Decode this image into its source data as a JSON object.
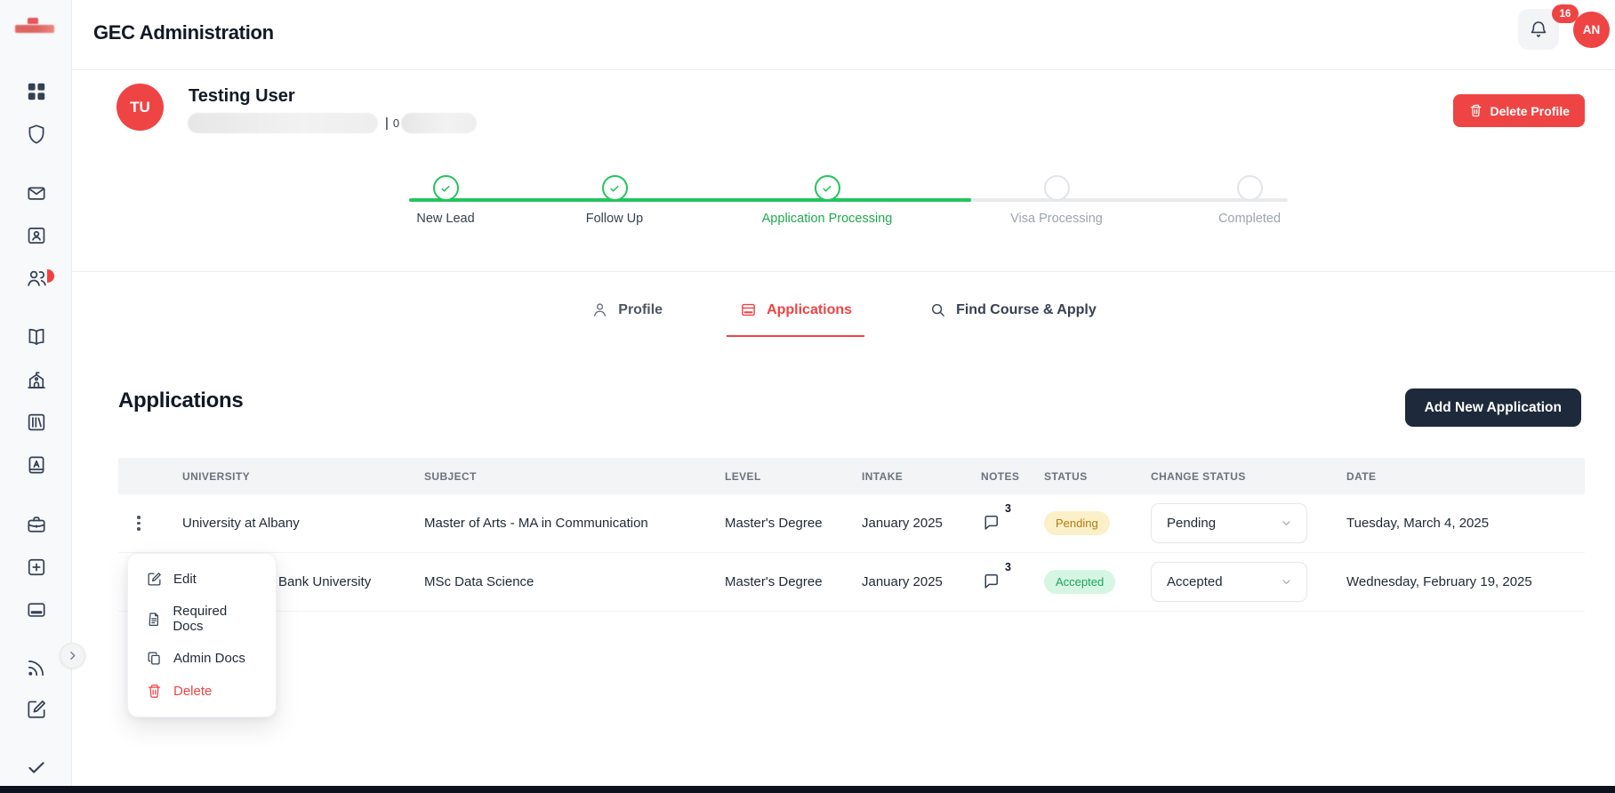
{
  "app": {
    "title": "GEC Administration",
    "notification_count": "16",
    "user_avatar_initials": "AN"
  },
  "sidebar": {
    "items": [
      "dashboard",
      "security",
      "mail",
      "contacts",
      "users",
      "courses",
      "school",
      "library",
      "dictionary",
      "jobs",
      "add-new",
      "payments",
      "feed",
      "compose",
      "tasks"
    ]
  },
  "profile": {
    "avatar_initials": "TU",
    "name": "Testing User",
    "masked_separator": "|",
    "masked_char": "0",
    "delete_button": "Delete Profile"
  },
  "stepper": {
    "steps": [
      {
        "label": "New Lead",
        "state": "done"
      },
      {
        "label": "Follow Up",
        "state": "done"
      },
      {
        "label": "Application Processing",
        "state": "current"
      },
      {
        "label": "Visa Processing",
        "state": "upcoming"
      },
      {
        "label": "Completed",
        "state": "upcoming"
      }
    ]
  },
  "tabs": [
    {
      "label": "Profile",
      "active": false
    },
    {
      "label": "Applications",
      "active": true
    },
    {
      "label": "Find Course & Apply",
      "active": false
    }
  ],
  "applications": {
    "heading": "Applications",
    "add_button": "Add New Application",
    "columns": [
      "UNIVERSITY",
      "SUBJECT",
      "LEVEL",
      "INTAKE",
      "NOTES",
      "STATUS",
      "CHANGE STATUS",
      "DATE"
    ],
    "rows": [
      {
        "university": "University at Albany",
        "subject": "Master of Arts - MA in Communication",
        "level": "Master's Degree",
        "intake": "January 2025",
        "notes_count": "3",
        "status": "Pending",
        "change_status": "Pending",
        "date": "Tuesday, March 4, 2025"
      },
      {
        "university": "Bank University",
        "subject": "MSc Data Science",
        "level": "Master's Degree",
        "intake": "January 2025",
        "notes_count": "3",
        "status": "Accepted",
        "change_status": "Accepted",
        "date": "Wednesday, February 19, 2025"
      }
    ]
  },
  "context_menu": {
    "items": [
      {
        "label": "Edit"
      },
      {
        "label": "Required Docs"
      },
      {
        "label": "Admin Docs"
      },
      {
        "label": "Delete"
      }
    ]
  },
  "colors": {
    "accent_red": "#ef4444",
    "success_green": "#22c55e",
    "dark_button": "#1e293b",
    "pending_bg": "#fbf0c8",
    "pending_text": "#b07b12",
    "accepted_bg": "#d5f6e3",
    "accepted_text": "#1da35c",
    "sidebar_icon": "#334155",
    "table_header_bg": "#f3f4f6"
  }
}
